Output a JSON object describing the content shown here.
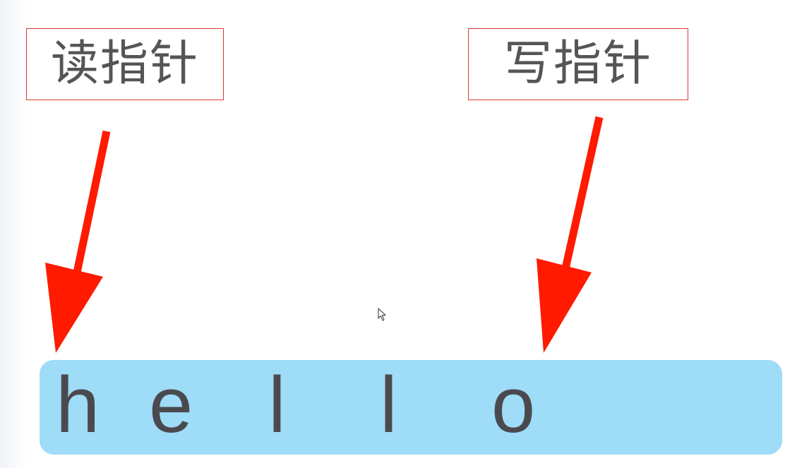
{
  "labels": {
    "read_pointer": "读指针",
    "write_pointer": "写指针"
  },
  "buffer": {
    "chars": [
      "h",
      "e",
      "l",
      "l",
      "o"
    ]
  },
  "colors": {
    "arrow": "#ff1a00",
    "label_border": "#d93a2f",
    "buffer_fill": "#9edcf7",
    "text": "#4a4a4e"
  },
  "icons": {
    "cursor": "mouse-pointer-icon"
  }
}
